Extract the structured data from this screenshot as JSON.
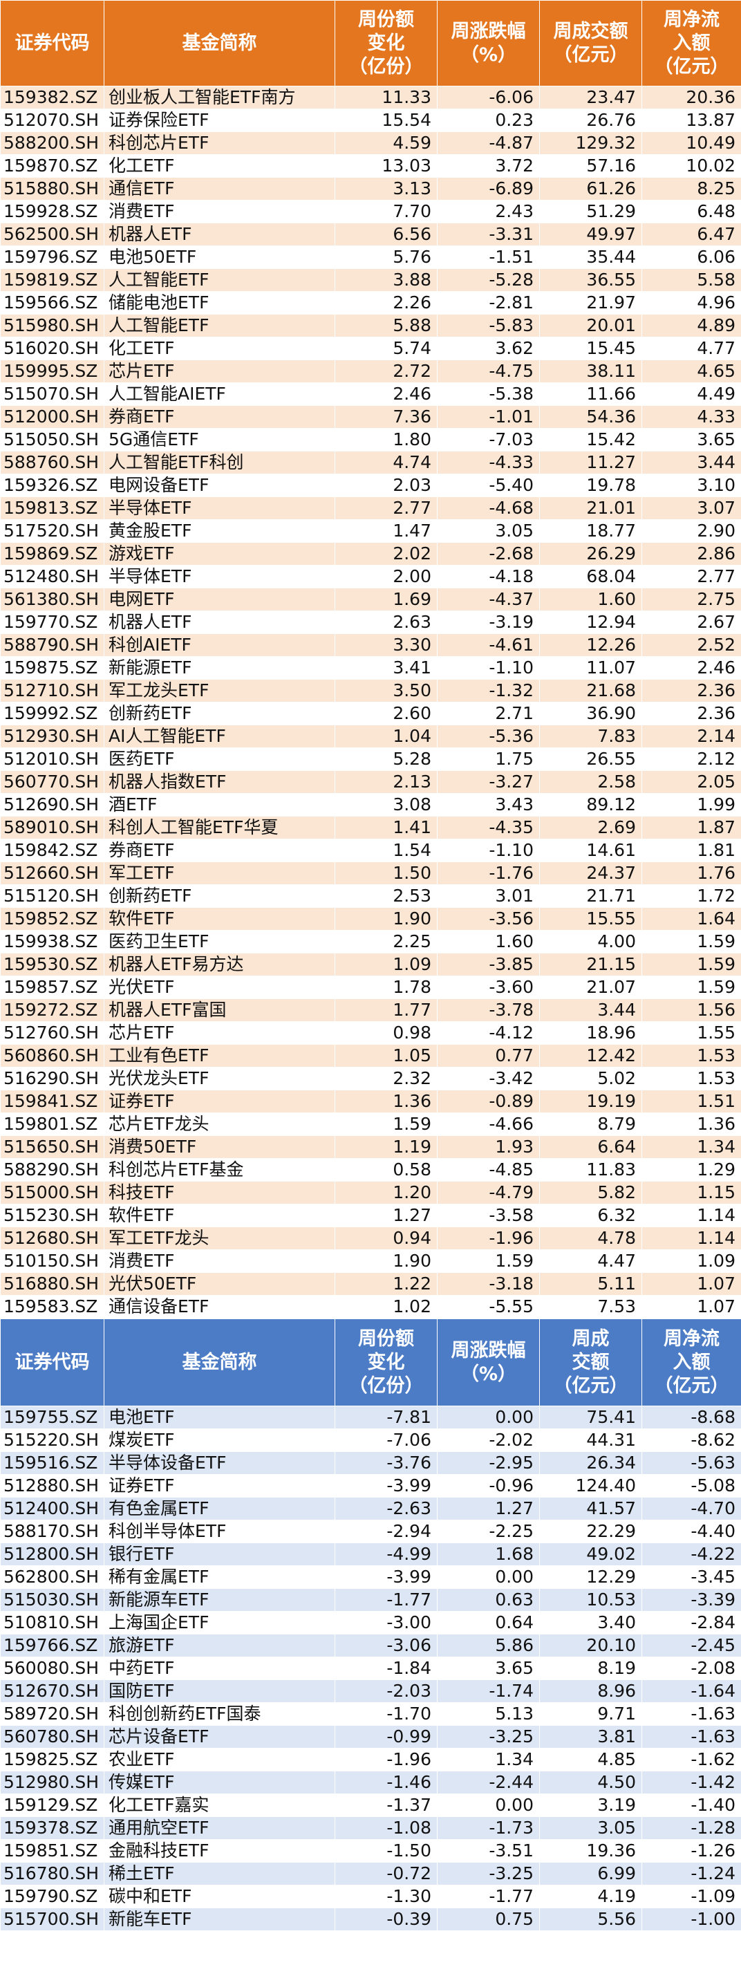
{
  "colors": {
    "inflow_header": "#e3761e",
    "inflow_stripe": "#fbe5d3",
    "outflow_header": "#4c7cc6",
    "outflow_stripe": "#dce6f4"
  },
  "inflow_table": {
    "headers": [
      "证券代码",
      "基金简称",
      "周份额\n变化\n（亿份）",
      "周涨跌幅\n（%）",
      "周成交额\n（亿元）",
      "周净流\n入额\n（亿元）"
    ],
    "rows": [
      [
        "159382.SZ",
        "创业板人工智能ETF南方",
        "11.33",
        "-6.06",
        "23.47",
        "20.36"
      ],
      [
        "512070.SH",
        "证券保险ETF",
        "15.54",
        "0.23",
        "26.76",
        "13.87"
      ],
      [
        "588200.SH",
        "科创芯片ETF",
        "4.59",
        "-4.87",
        "129.32",
        "10.49"
      ],
      [
        "159870.SZ",
        "化工ETF",
        "13.03",
        "3.72",
        "57.16",
        "10.02"
      ],
      [
        "515880.SH",
        "通信ETF",
        "3.13",
        "-6.89",
        "61.26",
        "8.25"
      ],
      [
        "159928.SZ",
        "消费ETF",
        "7.70",
        "2.43",
        "51.29",
        "6.48"
      ],
      [
        "562500.SH",
        "机器人ETF",
        "6.56",
        "-3.31",
        "49.97",
        "6.47"
      ],
      [
        "159796.SZ",
        "电池50ETF",
        "5.76",
        "-1.51",
        "35.44",
        "6.06"
      ],
      [
        "159819.SZ",
        "人工智能ETF",
        "3.88",
        "-5.28",
        "36.55",
        "5.58"
      ],
      [
        "159566.SZ",
        "储能电池ETF",
        "2.26",
        "-2.81",
        "21.97",
        "4.96"
      ],
      [
        "515980.SH",
        "人工智能ETF",
        "5.88",
        "-5.83",
        "20.01",
        "4.89"
      ],
      [
        "516020.SH",
        "化工ETF",
        "5.74",
        "3.62",
        "15.45",
        "4.77"
      ],
      [
        "159995.SZ",
        "芯片ETF",
        "2.72",
        "-4.75",
        "38.11",
        "4.65"
      ],
      [
        "515070.SH",
        "人工智能AIETF",
        "2.46",
        "-5.38",
        "11.66",
        "4.49"
      ],
      [
        "512000.SH",
        "券商ETF",
        "7.36",
        "-1.01",
        "54.36",
        "4.33"
      ],
      [
        "515050.SH",
        "5G通信ETF",
        "1.80",
        "-7.03",
        "15.42",
        "3.65"
      ],
      [
        "588760.SH",
        "人工智能ETF科创",
        "4.74",
        "-4.33",
        "11.27",
        "3.44"
      ],
      [
        "159326.SZ",
        "电网设备ETF",
        "2.03",
        "-5.40",
        "19.78",
        "3.10"
      ],
      [
        "159813.SZ",
        "半导体ETF",
        "2.77",
        "-4.68",
        "21.01",
        "3.07"
      ],
      [
        "517520.SH",
        "黄金股ETF",
        "1.47",
        "3.05",
        "18.77",
        "2.90"
      ],
      [
        "159869.SZ",
        "游戏ETF",
        "2.02",
        "-2.68",
        "26.29",
        "2.86"
      ],
      [
        "512480.SH",
        "半导体ETF",
        "2.00",
        "-4.18",
        "68.04",
        "2.77"
      ],
      [
        "561380.SH",
        "电网ETF",
        "1.69",
        "-4.37",
        "1.60",
        "2.75"
      ],
      [
        "159770.SZ",
        "机器人ETF",
        "2.63",
        "-3.19",
        "12.94",
        "2.67"
      ],
      [
        "588790.SH",
        "科创AIETF",
        "3.30",
        "-4.61",
        "12.26",
        "2.52"
      ],
      [
        "159875.SZ",
        "新能源ETF",
        "3.41",
        "-1.10",
        "11.07",
        "2.46"
      ],
      [
        "512710.SH",
        "军工龙头ETF",
        "3.50",
        "-1.32",
        "21.68",
        "2.36"
      ],
      [
        "159992.SZ",
        "创新药ETF",
        "2.60",
        "2.71",
        "36.90",
        "2.36"
      ],
      [
        "512930.SH",
        "AI人工智能ETF",
        "1.04",
        "-5.36",
        "7.83",
        "2.14"
      ],
      [
        "512010.SH",
        "医药ETF",
        "5.28",
        "1.75",
        "26.55",
        "2.12"
      ],
      [
        "560770.SH",
        "机器人指数ETF",
        "2.13",
        "-3.27",
        "2.58",
        "2.05"
      ],
      [
        "512690.SH",
        "酒ETF",
        "3.08",
        "3.43",
        "89.12",
        "1.99"
      ],
      [
        "589010.SH",
        "科创人工智能ETF华夏",
        "1.41",
        "-4.35",
        "2.69",
        "1.87"
      ],
      [
        "159842.SZ",
        "券商ETF",
        "1.54",
        "-1.10",
        "14.61",
        "1.81"
      ],
      [
        "512660.SH",
        "军工ETF",
        "1.50",
        "-1.76",
        "24.37",
        "1.76"
      ],
      [
        "515120.SH",
        "创新药ETF",
        "2.53",
        "3.01",
        "21.71",
        "1.72"
      ],
      [
        "159852.SZ",
        "软件ETF",
        "1.90",
        "-3.56",
        "15.55",
        "1.64"
      ],
      [
        "159938.SZ",
        "医药卫生ETF",
        "2.25",
        "1.60",
        "4.00",
        "1.59"
      ],
      [
        "159530.SZ",
        "机器人ETF易方达",
        "1.09",
        "-3.85",
        "21.15",
        "1.59"
      ],
      [
        "159857.SZ",
        "光伏ETF",
        "1.78",
        "-3.60",
        "21.07",
        "1.59"
      ],
      [
        "159272.SZ",
        "机器人ETF富国",
        "1.77",
        "-3.78",
        "3.44",
        "1.56"
      ],
      [
        "512760.SH",
        "芯片ETF",
        "0.98",
        "-4.12",
        "18.96",
        "1.55"
      ],
      [
        "560860.SH",
        "工业有色ETF",
        "1.05",
        "0.77",
        "12.42",
        "1.53"
      ],
      [
        "516290.SH",
        "光伏龙头ETF",
        "2.32",
        "-3.42",
        "5.02",
        "1.53"
      ],
      [
        "159841.SZ",
        "证券ETF",
        "1.36",
        "-0.89",
        "19.19",
        "1.51"
      ],
      [
        "159801.SZ",
        "芯片ETF龙头",
        "1.59",
        "-4.66",
        "8.79",
        "1.36"
      ],
      [
        "515650.SH",
        "消费50ETF",
        "1.19",
        "1.93",
        "6.64",
        "1.34"
      ],
      [
        "588290.SH",
        "科创芯片ETF基金",
        "0.58",
        "-4.85",
        "11.83",
        "1.29"
      ],
      [
        "515000.SH",
        "科技ETF",
        "1.20",
        "-4.79",
        "5.82",
        "1.15"
      ],
      [
        "515230.SH",
        "软件ETF",
        "1.27",
        "-3.58",
        "6.32",
        "1.14"
      ],
      [
        "512680.SH",
        "军工ETF龙头",
        "0.94",
        "-1.96",
        "4.78",
        "1.14"
      ],
      [
        "510150.SH",
        "消费ETF",
        "1.90",
        "1.59",
        "4.47",
        "1.09"
      ],
      [
        "516880.SH",
        "光伏50ETF",
        "1.22",
        "-3.18",
        "5.11",
        "1.07"
      ],
      [
        "159583.SZ",
        "通信设备ETF",
        "1.02",
        "-5.55",
        "7.53",
        "1.07"
      ]
    ]
  },
  "outflow_table": {
    "headers": [
      "证券代码",
      "基金简称",
      "周份额\n变化\n（亿份）",
      "周涨跌幅\n（%）",
      "周成\n交额\n（亿元）",
      "周净流\n入额\n（亿元）"
    ],
    "rows": [
      [
        "159755.SZ",
        "电池ETF",
        "-7.81",
        "0.00",
        "75.41",
        "-8.68"
      ],
      [
        "515220.SH",
        "煤炭ETF",
        "-7.06",
        "-2.02",
        "44.31",
        "-8.62"
      ],
      [
        "159516.SZ",
        "半导体设备ETF",
        "-3.76",
        "-2.95",
        "26.34",
        "-5.63"
      ],
      [
        "512880.SH",
        "证券ETF",
        "-3.99",
        "-0.96",
        "124.40",
        "-5.08"
      ],
      [
        "512400.SH",
        "有色金属ETF",
        "-2.63",
        "1.27",
        "41.57",
        "-4.70"
      ],
      [
        "588170.SH",
        "科创半导体ETF",
        "-2.94",
        "-2.25",
        "22.29",
        "-4.40"
      ],
      [
        "512800.SH",
        "银行ETF",
        "-4.99",
        "1.68",
        "49.02",
        "-4.22"
      ],
      [
        "562800.SH",
        "稀有金属ETF",
        "-3.99",
        "0.00",
        "12.29",
        "-3.45"
      ],
      [
        "515030.SH",
        "新能源车ETF",
        "-1.77",
        "0.63",
        "10.53",
        "-3.39"
      ],
      [
        "510810.SH",
        "上海国企ETF",
        "-3.00",
        "0.64",
        "3.40",
        "-2.84"
      ],
      [
        "159766.SZ",
        "旅游ETF",
        "-3.06",
        "5.86",
        "20.10",
        "-2.45"
      ],
      [
        "560080.SH",
        "中药ETF",
        "-1.84",
        "3.65",
        "8.19",
        "-2.08"
      ],
      [
        "512670.SH",
        "国防ETF",
        "-2.03",
        "-1.74",
        "8.96",
        "-1.64"
      ],
      [
        "589720.SH",
        "科创创新药ETF国泰",
        "-1.70",
        "5.13",
        "9.71",
        "-1.63"
      ],
      [
        "560780.SH",
        "芯片设备ETF",
        "-0.99",
        "-3.25",
        "3.81",
        "-1.63"
      ],
      [
        "159825.SZ",
        "农业ETF",
        "-1.96",
        "1.34",
        "4.85",
        "-1.62"
      ],
      [
        "512980.SH",
        "传媒ETF",
        "-1.46",
        "-2.44",
        "4.50",
        "-1.42"
      ],
      [
        "159129.SZ",
        "化工ETF嘉实",
        "-1.37",
        "0.00",
        "3.19",
        "-1.40"
      ],
      [
        "159378.SZ",
        "通用航空ETF",
        "-1.08",
        "-1.73",
        "3.05",
        "-1.28"
      ],
      [
        "159851.SZ",
        "金融科技ETF",
        "-1.50",
        "-3.51",
        "19.36",
        "-1.26"
      ],
      [
        "516780.SH",
        "稀土ETF",
        "-0.72",
        "-3.25",
        "6.99",
        "-1.24"
      ],
      [
        "159790.SZ",
        "碳中和ETF",
        "-1.30",
        "-1.77",
        "4.19",
        "-1.09"
      ],
      [
        "515700.SH",
        "新能车ETF",
        "-0.39",
        "0.75",
        "5.56",
        "-1.00"
      ]
    ]
  }
}
